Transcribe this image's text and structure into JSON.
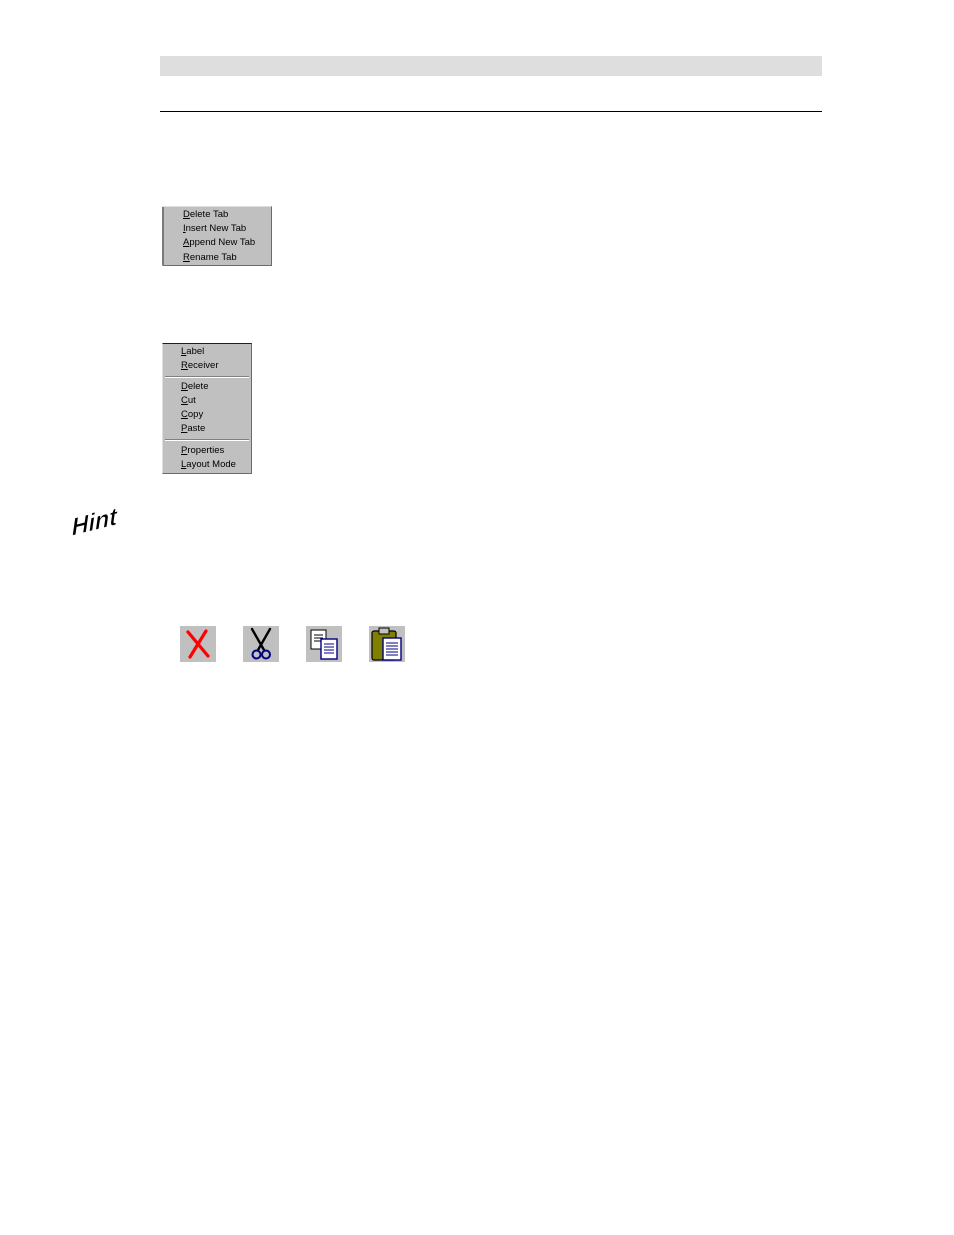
{
  "tab_menu": {
    "items": [
      {
        "accel": "D",
        "rest": "elete Tab"
      },
      {
        "accel": "I",
        "rest": "nsert New Tab"
      },
      {
        "accel": "A",
        "rest": "ppend New Tab"
      },
      {
        "accel": "R",
        "rest": "ename Tab"
      }
    ]
  },
  "context_menu": {
    "group1": [
      {
        "accel": "L",
        "rest": "abel"
      },
      {
        "accel": "R",
        "rest": "eceiver"
      }
    ],
    "group2": [
      {
        "accel": "D",
        "rest": "elete"
      },
      {
        "accel": "C",
        "rest": "ut"
      },
      {
        "accel": "C",
        "rest": "opy"
      },
      {
        "accel": "P",
        "rest": "aste"
      }
    ],
    "group3": [
      {
        "accel": "P",
        "rest": "roperties"
      },
      {
        "accel": "L",
        "rest": "ayout Mode"
      }
    ]
  },
  "hint": {
    "text": "Hint"
  },
  "toolbar_icons": [
    "delete-icon",
    "cut-icon",
    "copy-icon",
    "paste-icon"
  ],
  "colors": {
    "menu_bg": "#c0c0c0",
    "header_bar": "#dedede",
    "delete_red": "#ff0000",
    "doc_blue": "#000080",
    "clipboard_olive": "#808000"
  }
}
